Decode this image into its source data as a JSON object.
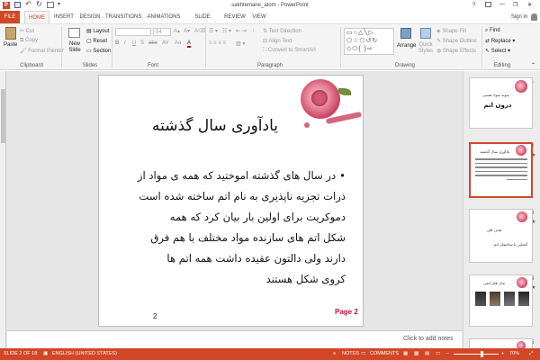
{
  "titlebar": {
    "title": "sakhtemane_atom - PowerPoint",
    "help": "?",
    "minimize": "—",
    "restore": "❐",
    "close": "✕"
  },
  "tabs": [
    "FILE",
    "HOME",
    "INSERT",
    "DESIGN",
    "TRANSITIONS",
    "ANIMATIONS",
    "SLIDE SHOW",
    "REVIEW",
    "VIEW"
  ],
  "sign_in": "Sign in",
  "ribbon": {
    "clipboard": {
      "paste": "Paste",
      "cut": "Cut",
      "copy": "Copy",
      "format_painter": "Format Painter",
      "label": "Clipboard"
    },
    "slides": {
      "new_slide": "New Slide",
      "layout": "Layout",
      "reset": "Reset",
      "section": "Section",
      "label": "Slides"
    },
    "font": {
      "size": "54",
      "label": "Font",
      "buttons": [
        "B",
        "I",
        "U",
        "S",
        "abc",
        "AV",
        "Aa",
        "A"
      ]
    },
    "paragraph": {
      "text_direction": "Text Direction",
      "align_text": "Align Text",
      "convert_smartart": "Convert to SmartArt",
      "label": "Paragraph"
    },
    "drawing": {
      "arrange": "Arrange",
      "quick_styles": "Quick Styles",
      "shape_fill": "Shape Fill",
      "shape_outline": "Shape Outline",
      "shape_effects": "Shape Effects",
      "label": "Drawing"
    },
    "editing": {
      "find": "Find",
      "replace": "Replace",
      "select": "Select",
      "label": "Editing"
    }
  },
  "slide": {
    "title": "یادآوری سال گذشته",
    "bullet": "•",
    "lines": [
      "در سال های گذشته اموختید که همه ی مواد از",
      "ذرات تجزیه ناپذیری به نام اتم ساخته شده است",
      "دموکریت برای اولین بار بیان کرد که همه",
      "شکل اتم های سازنده مواد مختلف با هم فرق",
      "دارند ولی دالتون عقیده داشت  همه اتم ها",
      "کروی شکل هستند"
    ],
    "page_label": "Page 2",
    "slide_number": "2"
  },
  "notes_placeholder": "Click to add notes",
  "thumbnails": [
    {
      "num": "1",
      "lines": [
        "نمونه سواد هستی",
        "درون اتم"
      ]
    },
    {
      "num": "2",
      "lines": [
        "یادآوری سال گذشته"
      ]
    },
    {
      "num": "3",
      "lines": [
        "هدف کلی",
        "آشنایی با ساختمان اتم"
      ]
    },
    {
      "num": "4",
      "lines": [
        "مدل های اتمی"
      ]
    },
    {
      "num": "5",
      "lines": []
    }
  ],
  "status": {
    "slide_of": "SLIDE 2 OF 18",
    "language": "ENGLISH (UNITED STATES)",
    "notes": "NOTES",
    "comments": "COMMENTS",
    "zoom": "70%"
  },
  "colors": {
    "accent": "#d24726",
    "page_label": "#c0143c"
  }
}
